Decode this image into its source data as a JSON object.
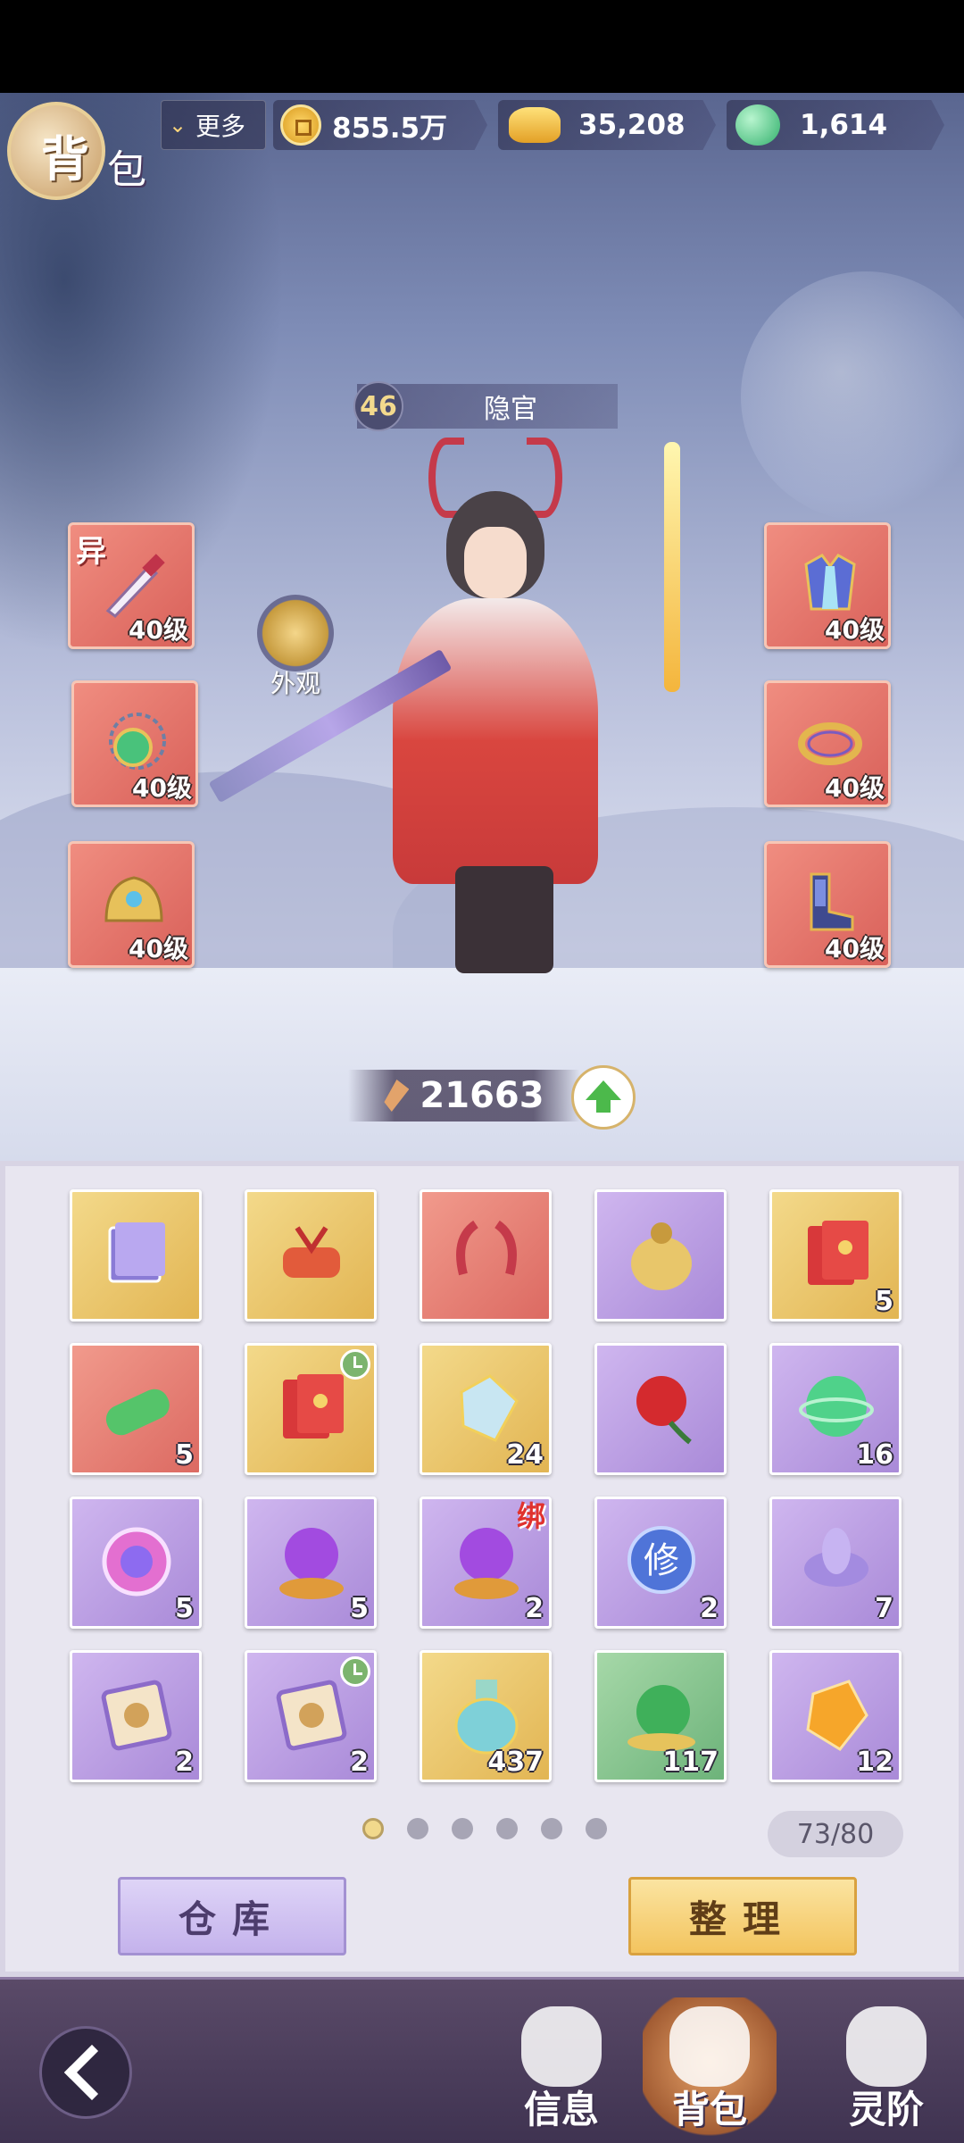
{
  "header": {
    "title_char1": "背",
    "title_char2": "包",
    "more_label": "更多",
    "resources": [
      {
        "icon": "copper-coin-icon",
        "value": "855.5万"
      },
      {
        "icon": "gold-ingot-icon",
        "value": "35,208"
      },
      {
        "icon": "jade-icon",
        "value": "1,614"
      }
    ]
  },
  "character": {
    "level": "46",
    "name": "隐官",
    "appearance_label": "外观",
    "power": "21663"
  },
  "equipment": {
    "left": [
      {
        "icon": "dagger-icon",
        "level": "40级",
        "tag": "异"
      },
      {
        "icon": "amulet-icon",
        "level": "40级"
      },
      {
        "icon": "helmet-icon",
        "level": "40级"
      }
    ],
    "right": [
      {
        "icon": "robe-icon",
        "level": "40级"
      },
      {
        "icon": "ring-icon",
        "level": "40级"
      },
      {
        "icon": "boots-icon",
        "level": "40级"
      }
    ]
  },
  "bag": {
    "items": [
      {
        "icon": "book-icon",
        "bg": "gold",
        "count": ""
      },
      {
        "icon": "scroll-icon",
        "bg": "gold",
        "count": ""
      },
      {
        "icon": "horns-icon",
        "bg": "red",
        "count": ""
      },
      {
        "icon": "money-bag-icon",
        "bg": "purple",
        "count": ""
      },
      {
        "icon": "red-envelope-icon",
        "bg": "gold",
        "count": "5"
      },
      {
        "icon": "bamboo-icon",
        "bg": "red",
        "count": "5"
      },
      {
        "icon": "red-envelope-icon",
        "bg": "gold",
        "count": "",
        "timed": true
      },
      {
        "icon": "crystal-icon",
        "bg": "gold",
        "count": "24"
      },
      {
        "icon": "rose-icon",
        "bg": "purple",
        "count": ""
      },
      {
        "icon": "green-orb-icon",
        "bg": "purple",
        "count": "16"
      },
      {
        "icon": "gem-icon",
        "bg": "purple",
        "count": "5"
      },
      {
        "icon": "purple-orb-icon",
        "bg": "purple",
        "count": "5"
      },
      {
        "icon": "purple-orb-icon",
        "bg": "purple",
        "count": "2",
        "bound": "绑"
      },
      {
        "icon": "cultivation-orb-icon",
        "bg": "purple",
        "count": "2",
        "orb_char": "修"
      },
      {
        "icon": "lotus-icon",
        "bg": "purple",
        "count": "7"
      },
      {
        "icon": "pet-card-icon",
        "bg": "purple",
        "count": "2"
      },
      {
        "icon": "pet-card-icon",
        "bg": "purple",
        "count": "2",
        "timed": true
      },
      {
        "icon": "potion-bottle-icon",
        "bg": "gold",
        "count": "437"
      },
      {
        "icon": "snail-orb-icon",
        "bg": "green",
        "count": "117"
      },
      {
        "icon": "amber-crystal-icon",
        "bg": "purple",
        "count": "12"
      }
    ],
    "pages": 6,
    "active_page": 1,
    "capacity": "73/80",
    "warehouse_label": "仓库",
    "sort_label": "整理"
  },
  "nav": {
    "items": [
      {
        "icon": "fist-icon",
        "label": "信息"
      },
      {
        "icon": "bag-icon",
        "label": "背包",
        "active": true
      },
      {
        "icon": "flame-icon",
        "label": "灵阶"
      }
    ]
  },
  "colors": {
    "gold_slot": "#e2b553",
    "red_slot": "#dc6a62",
    "purple_slot": "#a98ad8",
    "green_slot": "#6db37a",
    "power_up": "#4cb94b"
  }
}
